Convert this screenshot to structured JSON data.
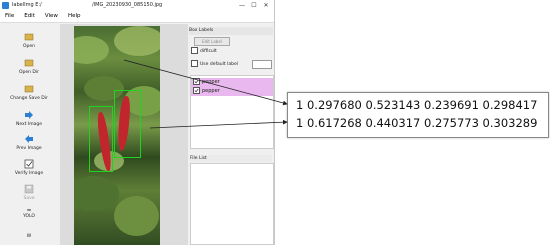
{
  "window": {
    "app_title": "labelImg E:/",
    "file_title": "/IMG_20230930_085150.jpg",
    "minimize": "—",
    "maximize": "☐",
    "close": "✕"
  },
  "menu": {
    "file": "File",
    "edit": "Edit",
    "view": "View",
    "help": "Help"
  },
  "toolbar": {
    "open": "Open",
    "open_dir": "Open Dir",
    "change_save_dir": "Change Save Dir",
    "next_image": "Next Image",
    "prev_image": "Prev Image",
    "verify_image": "Verify Image",
    "save": "Save",
    "format": "YOLO",
    "more": "≈",
    "more2": "W"
  },
  "box_labels": {
    "title": "Box Labels",
    "edit_label": "Edit Label",
    "difficult": "difficult",
    "use_default_label": "Use default label",
    "items": [
      {
        "label": "pepper",
        "checked": true
      },
      {
        "label": "pepper",
        "checked": true
      }
    ]
  },
  "file_list": {
    "title": "File List"
  },
  "yolo": {
    "lines": [
      "1 0.297680 0.523143 0.239691 0.298417",
      "1 0.617268 0.440317 0.275773 0.303289"
    ]
  },
  "colors": {
    "label_highlight": "#e9b8ee",
    "bbox": "#1fd31f",
    "accent": "#2d7fd3"
  }
}
